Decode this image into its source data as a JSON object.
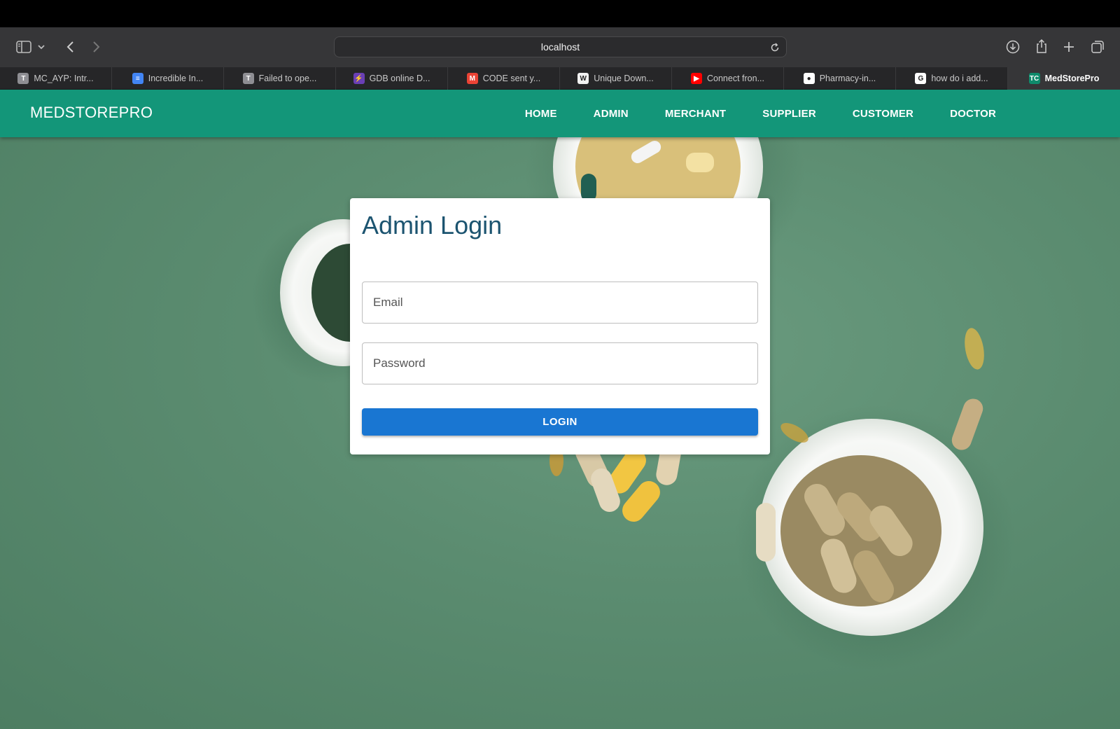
{
  "browser": {
    "url": "localhost",
    "tabs": [
      {
        "label": "MC_AYP: Intr...",
        "icon": "t-favicon-icon",
        "icon_letter": "T",
        "color": "#8e8e93"
      },
      {
        "label": "Incredible In...",
        "icon": "docs-favicon-icon",
        "icon_letter": "≡",
        "color": "#4285f4"
      },
      {
        "label": "Failed to ope...",
        "icon": "t-favicon-icon",
        "icon_letter": "T",
        "color": "#8e8e93"
      },
      {
        "label": "GDB online D...",
        "icon": "bolt-favicon-icon",
        "icon_letter": "⚡",
        "color": "#6a3fb5"
      },
      {
        "label": "CODE sent y...",
        "icon": "gmail-favicon-icon",
        "icon_letter": "M",
        "color": "#ea4335"
      },
      {
        "label": "Unique Down...",
        "icon": "wc-favicon-icon",
        "icon_letter": "W",
        "color": "#f2f2f2"
      },
      {
        "label": "Connect fron...",
        "icon": "youtube-favicon-icon",
        "icon_letter": "▶",
        "color": "#ff0000"
      },
      {
        "label": "Pharmacy-in...",
        "icon": "github-favicon-icon",
        "icon_letter": "●",
        "color": "#ffffff"
      },
      {
        "label": "how do i add...",
        "icon": "google-favicon-icon",
        "icon_letter": "G",
        "color": "#ffffff"
      },
      {
        "label": "MedStorePro",
        "icon": "tc-favicon-icon",
        "icon_letter": "TC",
        "color": "#0f8a6b",
        "active": true
      }
    ]
  },
  "navbar": {
    "brand": "MEDSTOREPRO",
    "items": [
      "HOME",
      "ADMIN",
      "MERCHANT",
      "SUPPLIER",
      "CUSTOMER",
      "DOCTOR"
    ]
  },
  "login": {
    "title": "Admin Login",
    "email_placeholder": "Email",
    "password_placeholder": "Password",
    "button_label": "LOGIN"
  },
  "colors": {
    "navbar": "#139679",
    "title": "#1c5470",
    "button": "#1976d2",
    "background": "#5b8c70"
  }
}
